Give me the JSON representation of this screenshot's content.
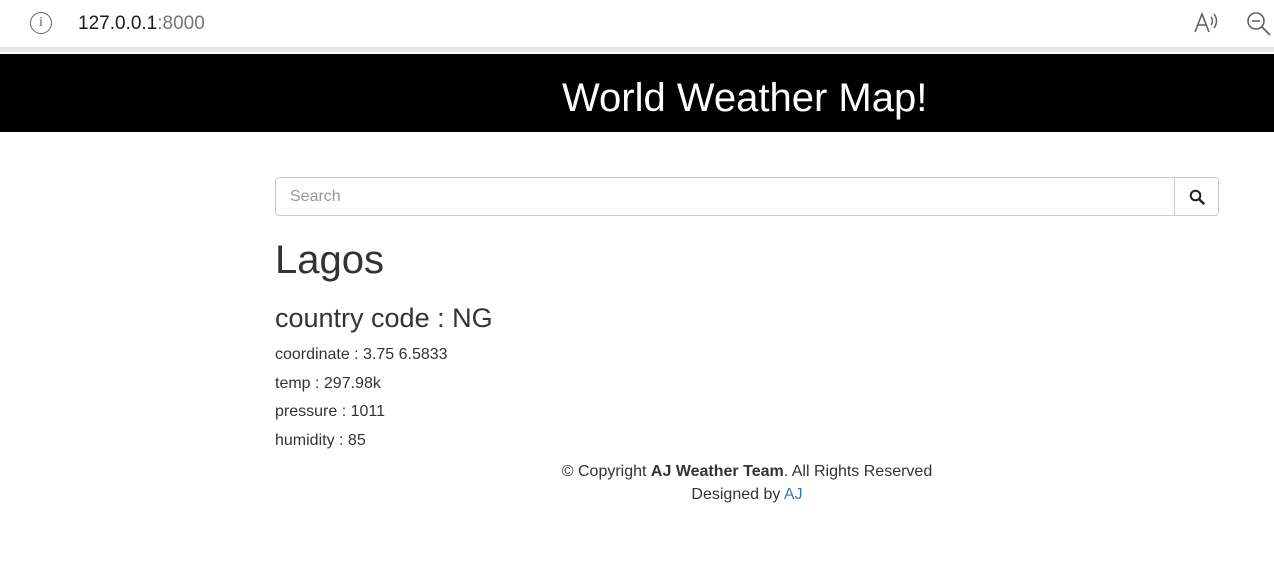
{
  "browser": {
    "url_host": "127.0.0.1",
    "url_port": ":8000",
    "icons": [
      "info-icon",
      "read-aloud-icon",
      "zoom-out-icon"
    ]
  },
  "header": {
    "title": "World Weather Map!"
  },
  "search": {
    "placeholder": "Search",
    "value": "",
    "button_icon": "search-icon"
  },
  "weather": {
    "city": "Lagos",
    "country_code": "country code : NG",
    "coordinate": "coordinate : 3.75 6.5833",
    "temp": "temp : 297.98k",
    "pressure": "pressure : 1011",
    "humidity": "humidity : 85"
  },
  "footer": {
    "copyright_prefix": "© Copyright ",
    "team": "AJ Weather Team",
    "rights": ". All Rights Reserved",
    "designed_by": "Designed by ",
    "designer": "AJ"
  },
  "colors": {
    "header_bg": "#000000",
    "header_text": "#ffffff",
    "link": "#337ab7",
    "text": "#333333"
  }
}
